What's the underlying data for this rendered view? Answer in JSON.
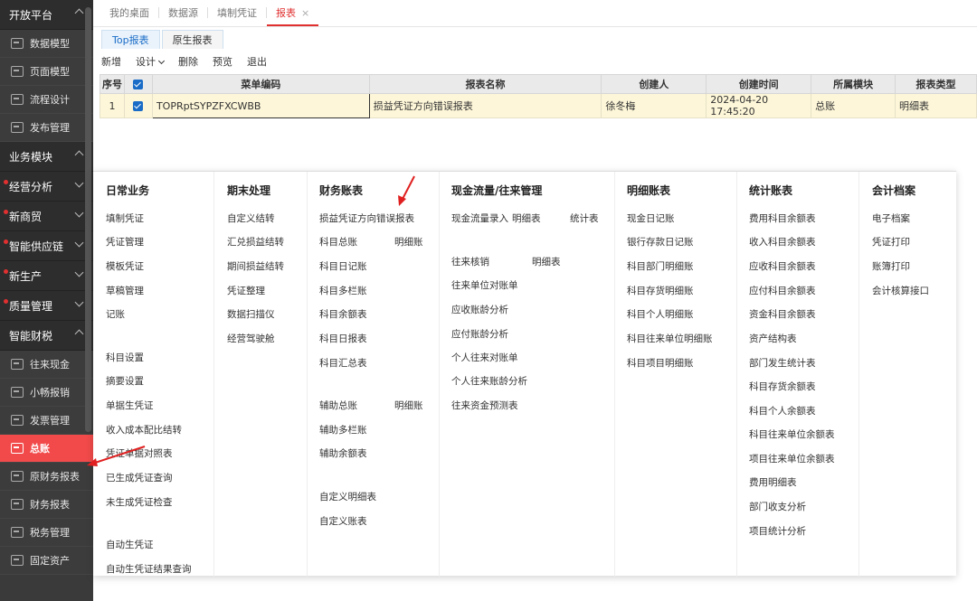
{
  "sidebar": {
    "groups": [
      {
        "label": "开放平台",
        "expanded": true
      },
      {
        "label": "业务模块",
        "expanded": true
      },
      {
        "label": "经营分析",
        "expanded": false,
        "dot": true
      },
      {
        "label": "新商贸",
        "expanded": false,
        "dot": true
      },
      {
        "label": "智能供应链",
        "expanded": false,
        "dot": true
      },
      {
        "label": "新生产",
        "expanded": false,
        "dot": true
      },
      {
        "label": "质量管理",
        "expanded": false,
        "dot": true
      },
      {
        "label": "智能财税",
        "expanded": true
      }
    ],
    "items_open": [
      "数据模型",
      "页面模型",
      "流程设计",
      "发布管理"
    ],
    "items_tax": [
      "往来现金",
      "小畅报销",
      "发票管理",
      "总账",
      "原财务报表",
      "财务报表",
      "税务管理",
      "固定资产"
    ],
    "active": "总账"
  },
  "tabs": [
    {
      "label": "我的桌面"
    },
    {
      "label": "数据源"
    },
    {
      "label": "填制凭证"
    },
    {
      "label": "报表",
      "active": true,
      "close": "×"
    }
  ],
  "subtabs": [
    {
      "label": "Top报表",
      "active": true
    },
    {
      "label": "原生报表"
    }
  ],
  "toolbar": {
    "new": "新增",
    "design": "设计",
    "delete": "删除",
    "preview": "预览",
    "exit": "退出"
  },
  "grid": {
    "headers": [
      "序号",
      "",
      "菜单编码",
      "报表名称",
      "创建人",
      "创建时间",
      "所属模块",
      "报表类型"
    ],
    "row": {
      "index": "1",
      "code": "TOPRptSYPZFXCWBB",
      "name": "损益凭证方向错误报表",
      "creator": "徐冬梅",
      "time": "2024-04-20 17:45:20",
      "module": "总账",
      "type": "明细表"
    }
  },
  "menu": {
    "daily": {
      "title": "日常业务",
      "items": [
        "填制凭证",
        "凭证管理",
        "模板凭证",
        "草稿管理",
        "记账",
        "科目设置",
        "摘要设置",
        "单据生凭证",
        "收入成本配比结转",
        "凭证单据对照表",
        "已生成凭证查询",
        "未生成凭证检查",
        "自动生凭证",
        "自动生凭证结果查询"
      ]
    },
    "period": {
      "title": "期末处理",
      "items": [
        "自定义结转",
        "汇兑损益结转",
        "期间损益结转",
        "凭证整理",
        "数据扫描仪",
        "经营驾驶舱"
      ]
    },
    "finance": {
      "title": "财务账表",
      "items": [
        "损益凭证方向错误报表",
        "科目总账",
        "明细账",
        "科目日记账",
        "科目多栏账",
        "科目余额表",
        "科目日报表",
        "科目汇总表",
        "辅助总账",
        "明细账",
        "辅助多栏账",
        "辅助余额表",
        "自定义明细表",
        "自定义账表"
      ]
    },
    "cash": {
      "title": "现金流量/往来管理",
      "items": [
        "现金流量录入",
        "明细表",
        "统计表",
        "往来核销",
        "明细表",
        "往来单位对账单",
        "应收账龄分析",
        "应付账龄分析",
        "个人往来对账单",
        "个人往来账龄分析",
        "往来资金预测表"
      ]
    },
    "detail": {
      "title": "明细账表",
      "items": [
        "现金日记账",
        "银行存款日记账",
        "科目部门明细账",
        "科目存货明细账",
        "科目个人明细账",
        "科目往来单位明细账",
        "科目项目明细账"
      ]
    },
    "stats": {
      "title": "统计账表",
      "items": [
        "费用科目余额表",
        "收入科目余额表",
        "应收科目余额表",
        "应付科目余额表",
        "资金科目余额表",
        "资产结构表",
        "部门发生统计表",
        "科目存货余额表",
        "科目个人余额表",
        "科目往来单位余额表",
        "项目往来单位余额表",
        "费用明细表",
        "部门收支分析",
        "项目统计分析"
      ]
    },
    "archive": {
      "title": "会计档案",
      "items": [
        "电子档案",
        "凭证打印",
        "账簿打印",
        "会计核算接口"
      ]
    }
  },
  "colors": {
    "accent": "#e03030",
    "active_item": "#f24a4a",
    "link": "#1a6cc7"
  }
}
